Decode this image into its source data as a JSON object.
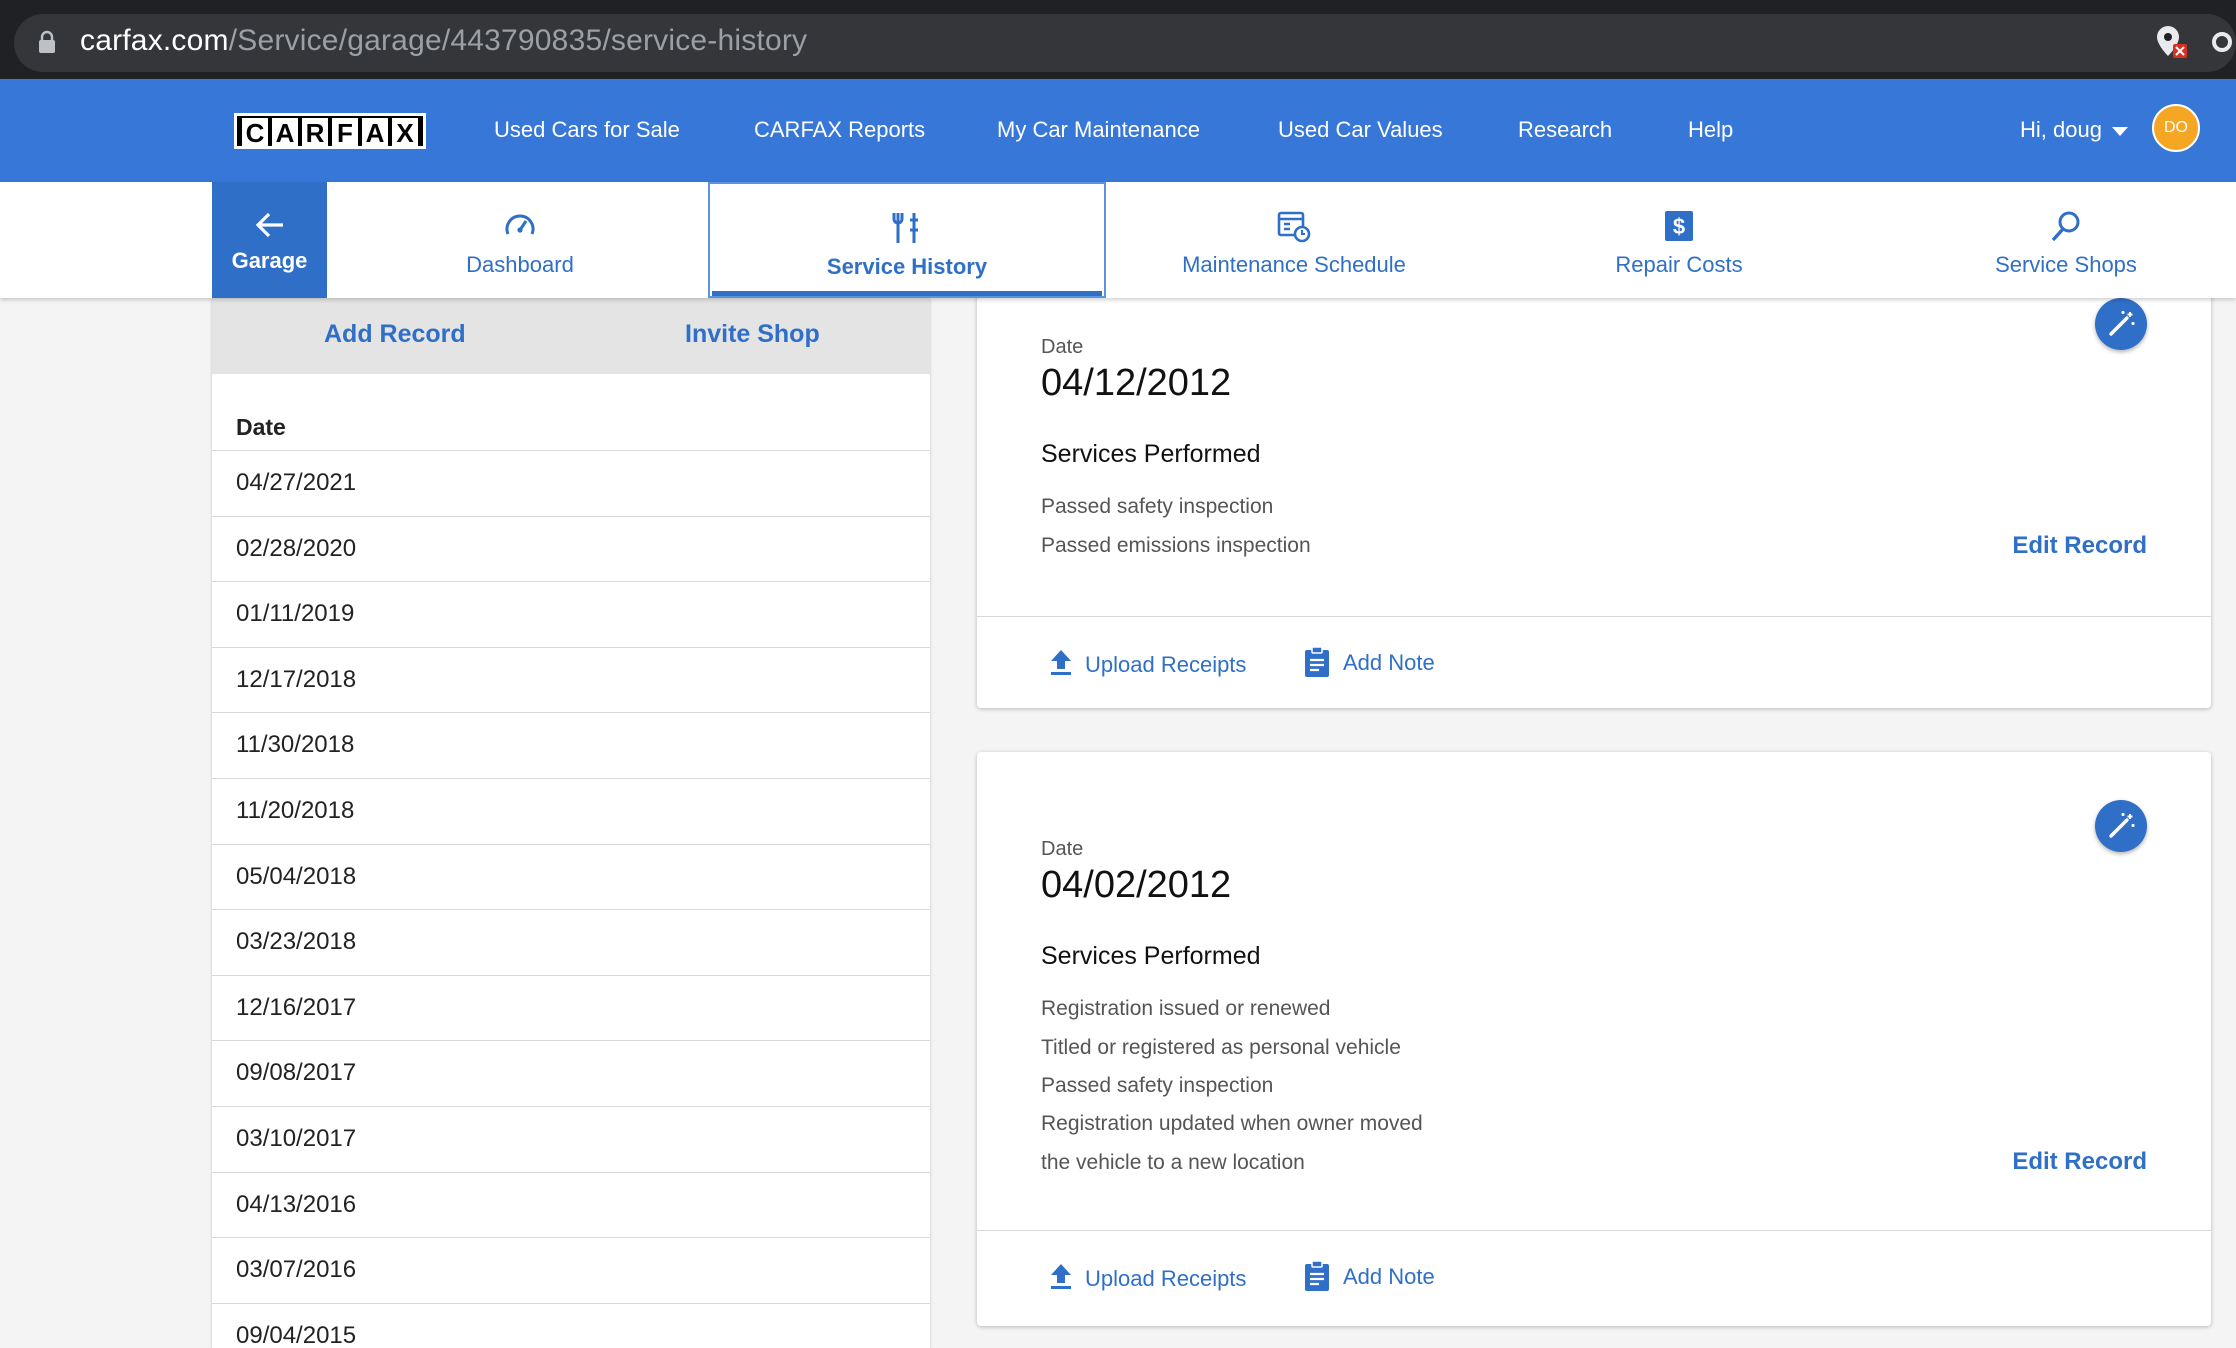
{
  "browser": {
    "url_host": "carfax.com",
    "url_path": "/Service/garage/443790835/service-history"
  },
  "topnav": {
    "logo_letters": [
      "C",
      "A",
      "R",
      "F",
      "A",
      "X"
    ],
    "links": [
      "Used Cars for Sale",
      "CARFAX Reports",
      "My Car Maintenance",
      "Used Car Values",
      "Research",
      "Help"
    ],
    "greeting": "Hi, doug",
    "avatar_initials": "DO",
    "colors": {
      "nav_bg": "#3777d8",
      "avatar_bg": "#f5a623"
    }
  },
  "tabs": {
    "garage_label": "Garage",
    "items": [
      {
        "label": "Dashboard",
        "icon": "speedometer-icon"
      },
      {
        "label": "Service History",
        "icon": "tools-icon",
        "active": true
      },
      {
        "label": "Maintenance Schedule",
        "icon": "calendar-clock-icon"
      },
      {
        "label": "Repair Costs",
        "icon": "dollar-icon"
      },
      {
        "label": "Service Shops",
        "icon": "search-icon"
      }
    ]
  },
  "left_panel": {
    "add_record": "Add Record",
    "invite_shop": "Invite Shop",
    "column_header": "Date",
    "dates": [
      "04/27/2021",
      "02/28/2020",
      "01/11/2019",
      "12/17/2018",
      "11/30/2018",
      "11/20/2018",
      "05/04/2018",
      "03/23/2018",
      "12/16/2017",
      "09/08/2017",
      "03/10/2017",
      "04/13/2016",
      "03/07/2016",
      "09/04/2015"
    ]
  },
  "records": [
    {
      "date_label": "Date",
      "date": "04/12/2012",
      "services_heading": "Services Performed",
      "services": [
        "Passed safety inspection",
        "Passed emissions inspection"
      ],
      "edit_label": "Edit Record",
      "upload_label": "Upload Receipts",
      "note_label": "Add Note"
    },
    {
      "date_label": "Date",
      "date": "04/02/2012",
      "services_heading": "Services Performed",
      "services": [
        "Registration issued or renewed",
        "Titled or registered as personal vehicle",
        "Passed safety inspection",
        "Registration updated when owner moved",
        "the vehicle to a new location"
      ],
      "edit_label": "Edit Record",
      "upload_label": "Upload Receipts",
      "note_label": "Add Note"
    }
  ]
}
